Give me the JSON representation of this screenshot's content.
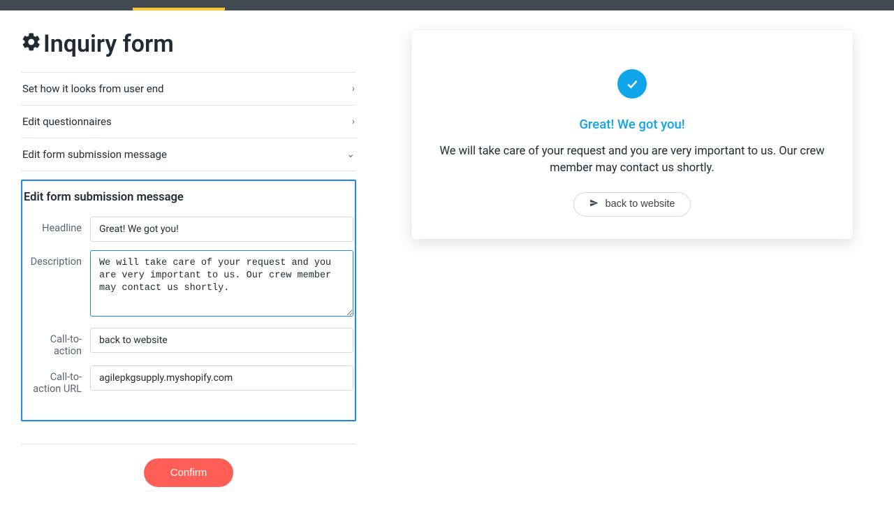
{
  "page": {
    "title": "Inquiry form"
  },
  "accordion": {
    "items": [
      {
        "label": "Set how it looks from user end",
        "expanded": false
      },
      {
        "label": "Edit questionnaires",
        "expanded": false
      },
      {
        "label": "Edit form submission message",
        "expanded": true
      }
    ]
  },
  "panel": {
    "title": "Edit form submission message",
    "fields": {
      "headline": {
        "label": "Headline",
        "value": "Great! We got you!"
      },
      "description": {
        "label": "Description",
        "value": "We will take care of your request and you are very important to us. Our crew member may contact us shortly."
      },
      "cta": {
        "label": "Call-to-action",
        "value": "back to website"
      },
      "cta_url": {
        "label": "Call-to-action URL",
        "value": "agilepkgsupply.myshopify.com"
      }
    }
  },
  "confirm_label": "Confirm",
  "preview": {
    "headline": "Great! We got you!",
    "description": "We will take care of your request and you are very important to us. Our crew member may contact us shortly.",
    "cta_label": "back to website"
  }
}
